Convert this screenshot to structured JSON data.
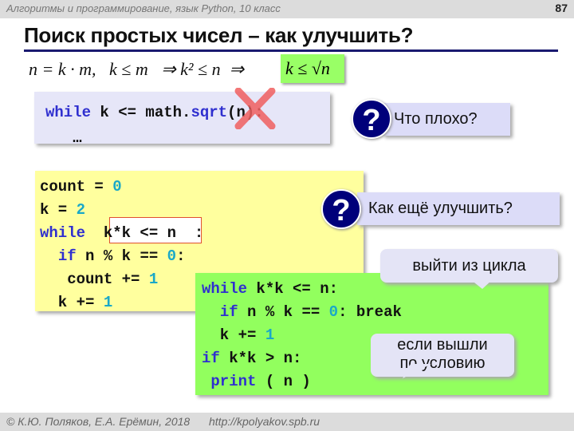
{
  "header": {
    "course": "Алгоритмы и программирование, язык Python, 10 класс",
    "slide_number": "87"
  },
  "title": "Поиск простых чисел – как улучшить?",
  "formula": {
    "text": "n = k · m,   k ≤ m   ⇒ k² ≤ n  ⇒",
    "highlight": "k ≤ √n"
  },
  "box1": {
    "lines": [
      [
        [
          "kw",
          "while"
        ],
        [
          "tx",
          " k <= math."
        ],
        [
          "kw",
          "sqrt"
        ],
        [
          "tx",
          "(n):"
        ]
      ],
      [
        [
          "tx",
          "   …"
        ]
      ]
    ]
  },
  "question1": {
    "icon": "question-icon",
    "symbol": "?",
    "text": "Что плохо?"
  },
  "question2": {
    "icon": "question-icon",
    "symbol": "?",
    "text": "Как ещё улучшить?"
  },
  "yellow_code": {
    "lines": [
      [
        [
          "tx",
          "count = "
        ],
        [
          "num",
          "0"
        ]
      ],
      [
        [
          "tx",
          "k = "
        ],
        [
          "num",
          "2"
        ]
      ],
      [
        [
          "kw",
          "while"
        ],
        [
          "tx",
          "  k*k <= n  :"
        ]
      ],
      [
        [
          "tx",
          "  "
        ],
        [
          "kw",
          "if"
        ],
        [
          "tx",
          " n % k == "
        ],
        [
          "num",
          "0"
        ],
        [
          "tx",
          ":"
        ]
      ],
      [
        [
          "tx",
          "   count += "
        ],
        [
          "num",
          "1"
        ]
      ],
      [
        [
          "tx",
          "  k += "
        ],
        [
          "num",
          "1"
        ]
      ]
    ]
  },
  "green_code": {
    "lines": [
      [
        [
          "kw",
          "while"
        ],
        [
          "tx",
          " k*k <= n:"
        ]
      ],
      [
        [
          "tx",
          "  "
        ],
        [
          "kw",
          "if"
        ],
        [
          "tx",
          " n % k == "
        ],
        [
          "num",
          "0"
        ],
        [
          "tx",
          ": break"
        ]
      ],
      [
        [
          "tx",
          "  k += "
        ],
        [
          "num",
          "1"
        ]
      ],
      [
        [
          "kw",
          "if"
        ],
        [
          "tx",
          " k*k > n:"
        ]
      ],
      [
        [
          "tx",
          " "
        ],
        [
          "kw",
          "print"
        ],
        [
          "tx",
          " ( n )"
        ]
      ]
    ]
  },
  "callouts": {
    "exit_loop": "выйти из цикла",
    "by_condition_1": "если вышли",
    "by_condition_2": "по условию"
  },
  "footer": {
    "authors": "© К.Ю. Поляков, Е.А. Ерёмин, 2018",
    "url": "http://kpolyakov.spb.ru"
  },
  "colors": {
    "keyword": "#2f2fcf",
    "number": "#1aa8c8",
    "yellow_box": "#ffff9e",
    "green_box": "#92ff5e",
    "question_circle": "#00007a",
    "cross": "#f06060"
  }
}
